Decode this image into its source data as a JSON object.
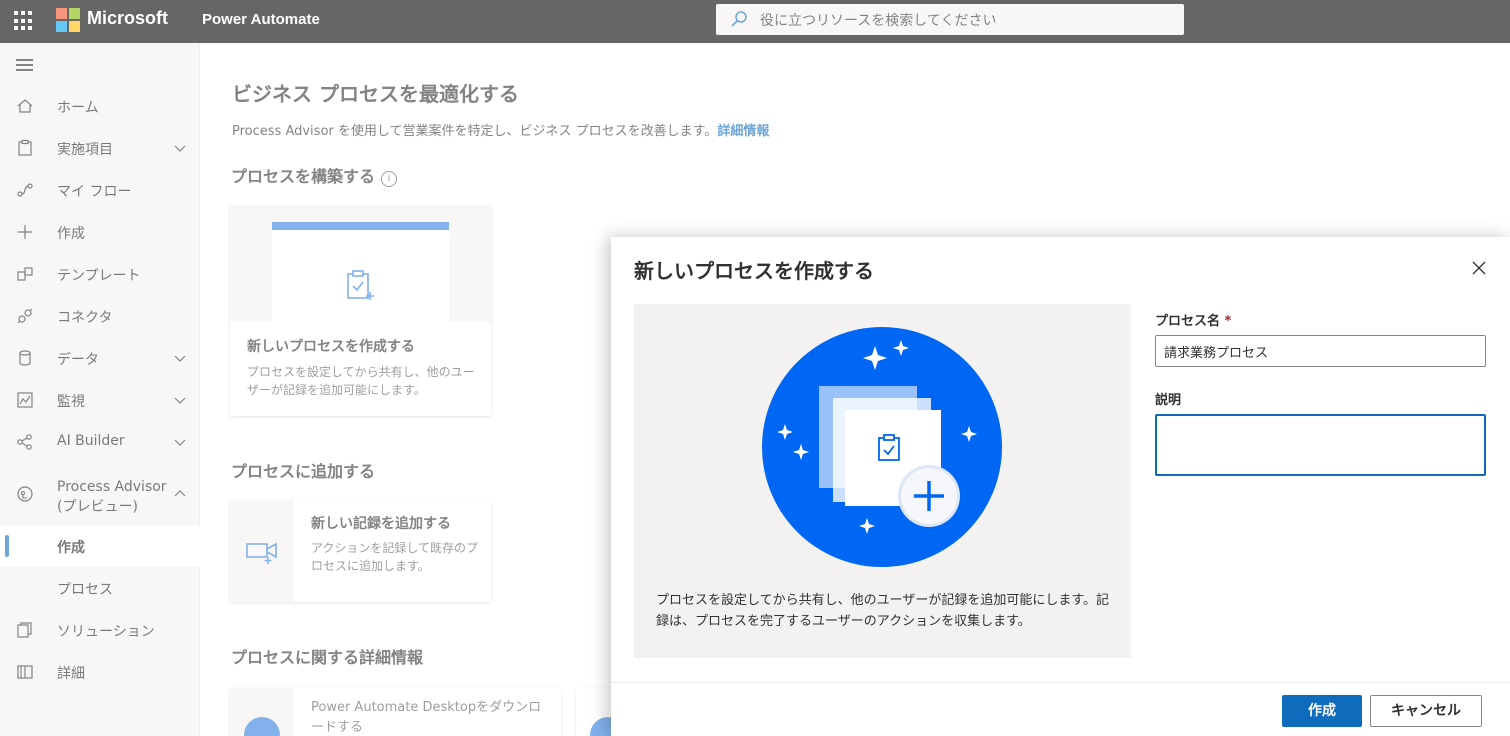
{
  "topbar": {
    "brand": "Microsoft",
    "app_name": "Power Automate",
    "search_placeholder": "役に立つリソースを検索してください"
  },
  "sidebar": {
    "items": [
      {
        "label": "ホーム",
        "icon": "home-icon"
      },
      {
        "label": "実施項目",
        "icon": "clipboard-icon",
        "expandable": true
      },
      {
        "label": "マイ フロー",
        "icon": "flow-icon"
      },
      {
        "label": "作成",
        "icon": "plus-icon"
      },
      {
        "label": "テンプレート",
        "icon": "template-icon"
      },
      {
        "label": "コネクタ",
        "icon": "connector-icon"
      },
      {
        "label": "データ",
        "icon": "database-icon",
        "expandable": true
      },
      {
        "label": "監視",
        "icon": "monitor-icon",
        "expandable": true
      },
      {
        "label": "AI Builder",
        "icon": "ai-builder-icon",
        "expandable": true
      },
      {
        "label": "Process Advisor\n(プレビュー)",
        "icon": "process-advisor-icon",
        "expanded": true
      },
      {
        "label": "作成",
        "active": true
      },
      {
        "label": "プロセス"
      },
      {
        "label": "ソリューション",
        "icon": "solution-icon"
      },
      {
        "label": "詳細",
        "icon": "book-icon"
      }
    ]
  },
  "main": {
    "title": "ビジネス プロセスを最適化する",
    "subtitle": "Process Advisor を使用して営業案件を特定し、ビジネス プロセスを改善します。",
    "subtitle_link": "詳細情報",
    "section_build": "プロセスを構築する",
    "build_card": {
      "title": "新しいプロセスを作成する",
      "desc": "プロセスを設定してから共有し、他のユーザーが記録を追加可能にします。"
    },
    "section_add": "プロセスに追加する",
    "add_card": {
      "title": "新しい記録を追加する",
      "desc": "アクションを記録して既存のプロセスに追加します。"
    },
    "section_details": "プロセスに関する詳細情報",
    "detail_card": {
      "title": "Power Automate Desktopをダウンロードする"
    }
  },
  "panel": {
    "title": "新しいプロセスを作成する",
    "illustration_text": "プロセスを設定してから共有し、他のユーザーが記録を追加可能にします。記録は、プロセスを完了するユーザーのアクションを収集します。",
    "name_label": "プロセス名",
    "required_mark": "*",
    "name_value": "請求業務プロセス",
    "desc_label": "説明",
    "desc_value": "",
    "create_button": "作成",
    "cancel_button": "キャンセル"
  },
  "colors": {
    "accent": "#0f6cbd",
    "illustration_blue": "#0067f5",
    "topbar": "#000000",
    "sidebar_bg": "#f3f2f1"
  }
}
